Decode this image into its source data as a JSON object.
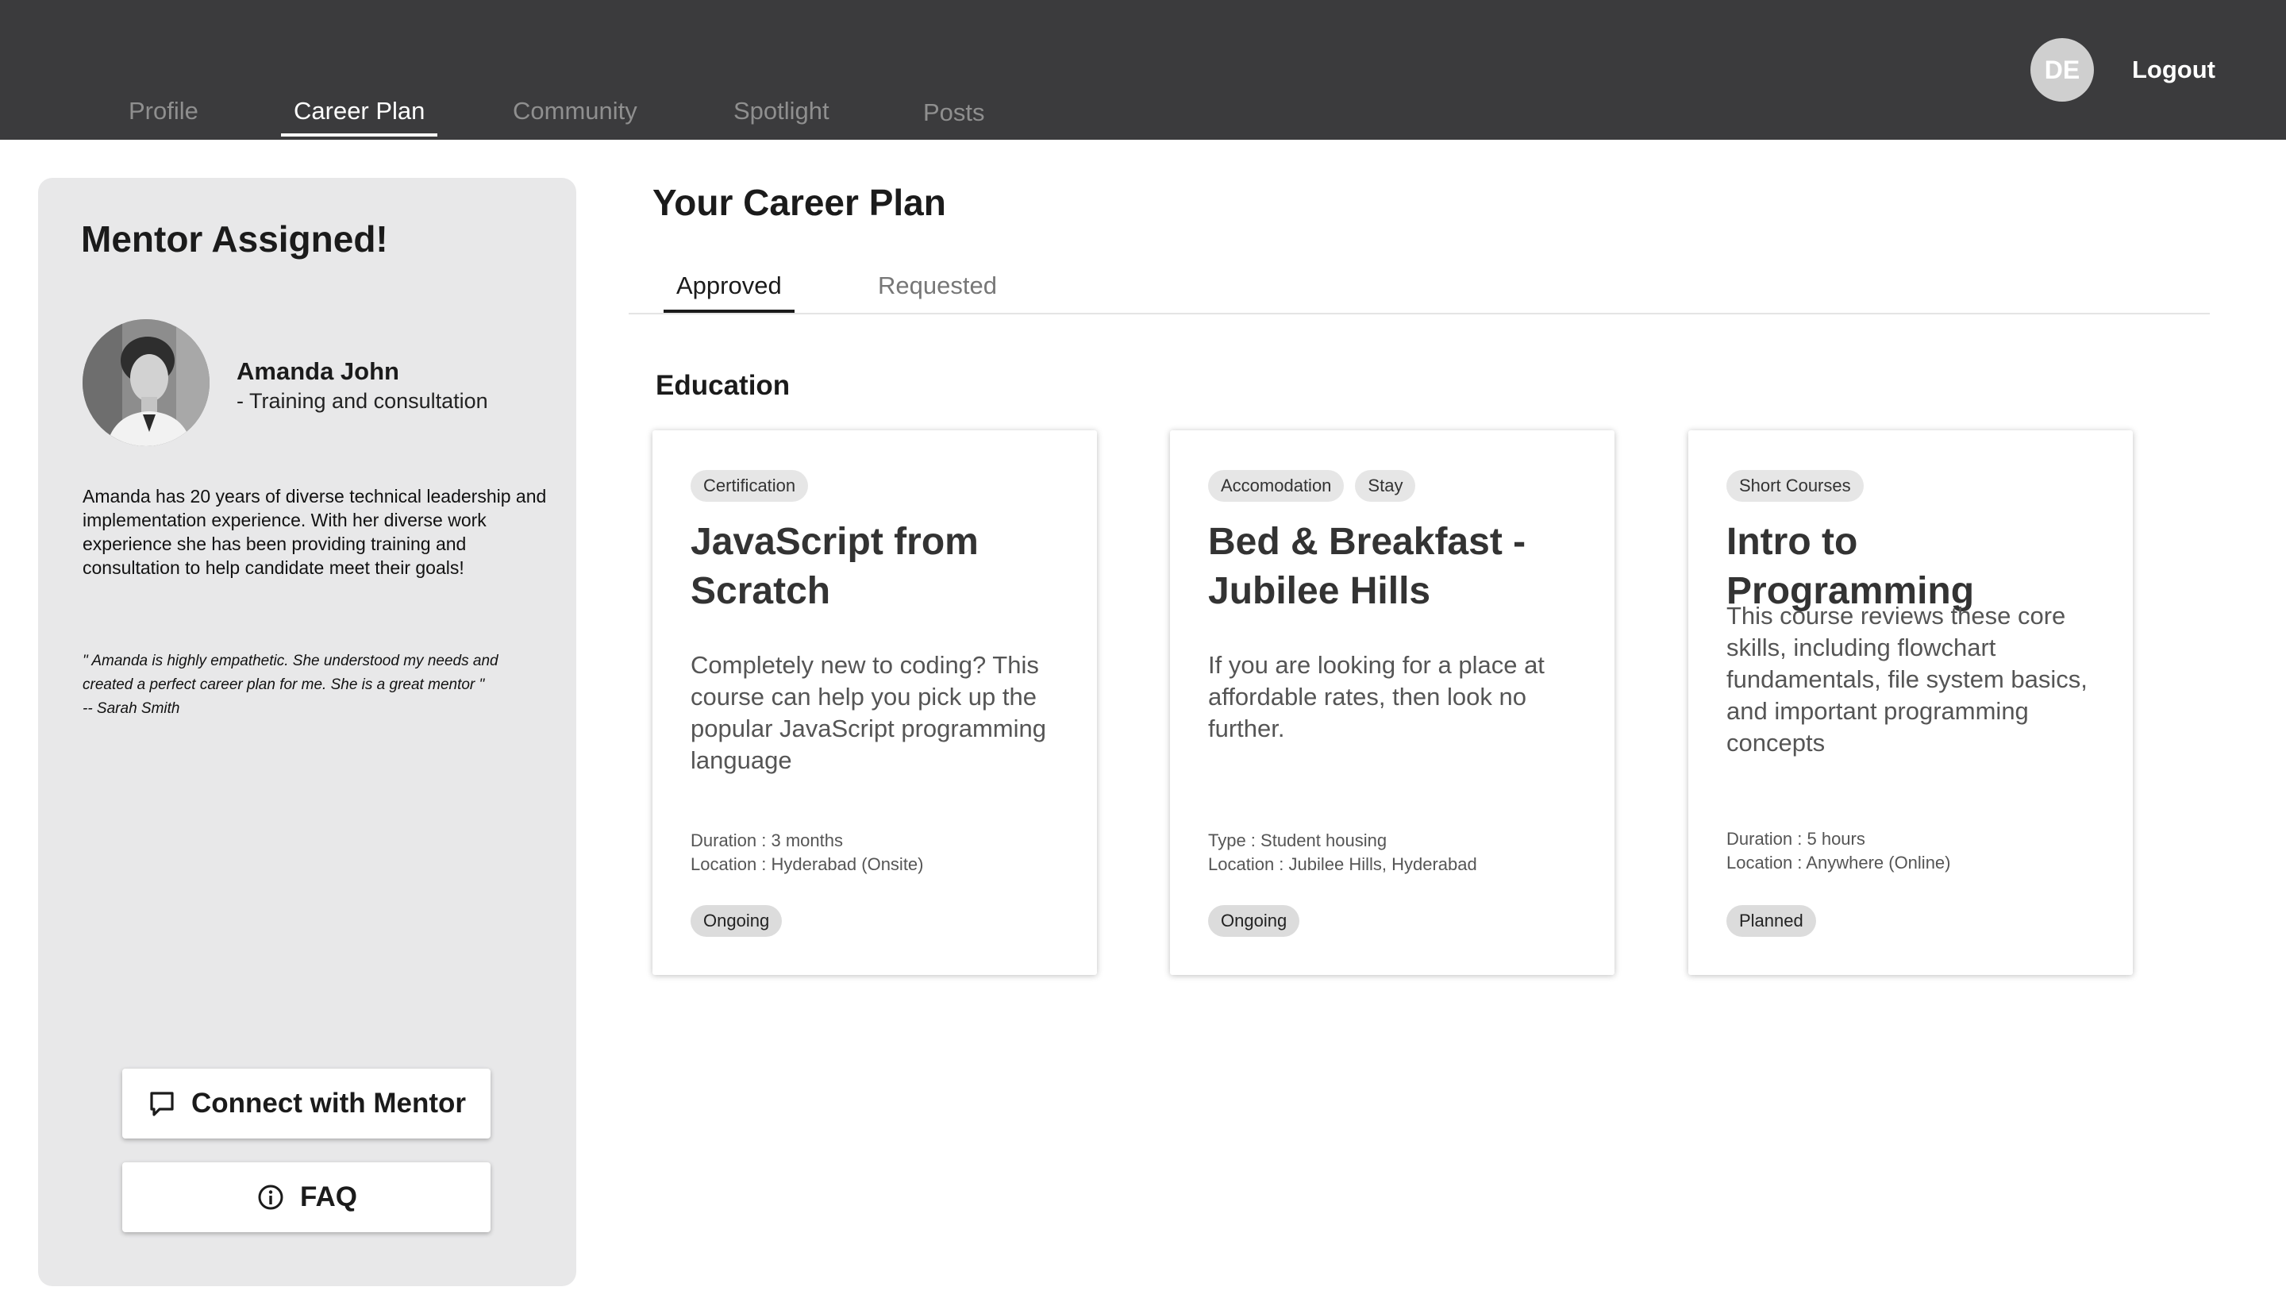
{
  "nav": {
    "items": [
      {
        "label": "Profile"
      },
      {
        "label": "Career Plan"
      },
      {
        "label": "Community"
      },
      {
        "label": "Spotlight"
      },
      {
        "label": "Posts"
      }
    ],
    "active": "Career Plan",
    "user_initials": "DE",
    "logout_label": "Logout"
  },
  "mentor": {
    "heading": "Mentor Assigned!",
    "name": "Amanda John",
    "role": "- Training and consultation",
    "bio": "Amanda has 20 years of diverse technical leadership and implementation experience. With her diverse work experience she has been providing training and consultation to help candidate meet their goals!",
    "quote_line1": "\" Amanda is highly empathetic. She understood my needs and",
    "quote_line2": "created a perfect career plan for me. She is a great mentor \"",
    "quote_author": "-- Sarah Smith",
    "connect_label": "Connect with Mentor",
    "faq_label": "FAQ"
  },
  "main": {
    "title": "Your Career Plan",
    "tabs": [
      {
        "label": "Approved"
      },
      {
        "label": "Requested"
      }
    ],
    "active_tab": "Approved",
    "section_title": "Education",
    "cards": [
      {
        "tags": [
          "Certification"
        ],
        "title": "JavaScript from Scratch",
        "description": "Completely new to coding? This course can help you pick up the popular JavaScript programming language",
        "meta_line1": "Duration : 3 months",
        "meta_line2": "Location : Hyderabad (Onsite)",
        "status": "Ongoing"
      },
      {
        "tags": [
          "Accomodation",
          "Stay"
        ],
        "title": "Bed & Breakfast - Jubilee Hills",
        "description": "If you are looking for a place at affordable rates, then look no further.",
        "meta_line1": "Type : Student housing",
        "meta_line2": "Location : Jubilee Hills, Hyderabad",
        "status": "Ongoing"
      },
      {
        "tags": [
          "Short Courses"
        ],
        "title": "Intro to Programming",
        "description": "This course reviews these core skills, including flowchart fundamentals, file system basics, and important programming concepts",
        "meta_line1": "Duration : 5 hours",
        "meta_line2": "Location : Anywhere (Online)",
        "status": "Planned"
      }
    ]
  },
  "colors": {
    "topbar": "#3b3b3d",
    "panel": "#e8e8e9",
    "accent_text": "#1b1b1b"
  }
}
